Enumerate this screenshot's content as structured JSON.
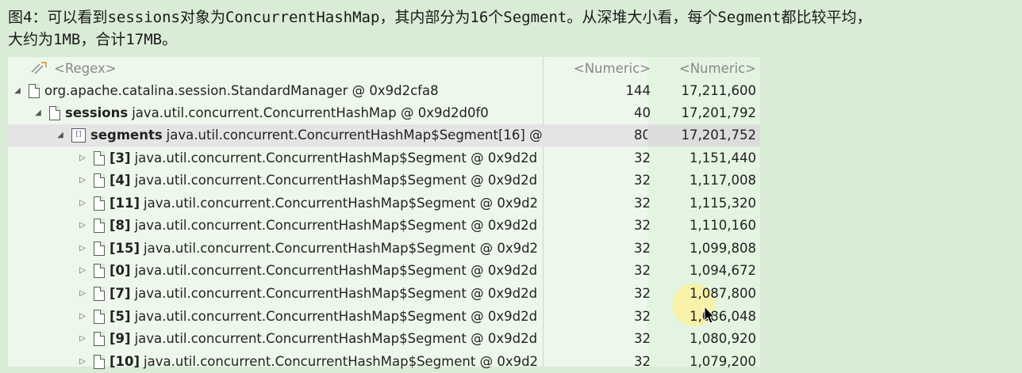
{
  "caption": {
    "line1": "图4：可以看到sessions对象为ConcurrentHashMap，其内部分为16个Segment。从深堆大小看，每个Segment都比较平均，",
    "line2": "大约为1MB，合计17MB。"
  },
  "header": {
    "regex": "<Regex>",
    "numeric1": "<Numeric>",
    "numeric2": "<Numeric>"
  },
  "rows": [
    {
      "label": "",
      "text": "org.apache.catalina.session.StandardManager @ 0x9d2cfa8",
      "n1": "144",
      "n2": "17,211,600"
    },
    {
      "label": "sessions",
      "text": "java.util.concurrent.ConcurrentHashMap @ 0x9d2d0f0",
      "n1": "40",
      "n2": "17,201,792"
    },
    {
      "label": "segments",
      "text": "java.util.concurrent.ConcurrentHashMap$Segment[16] @",
      "n1": "80",
      "n2": "17,201,752",
      "icon_text": "[]"
    },
    {
      "label": "[3]",
      "text": "java.util.concurrent.ConcurrentHashMap$Segment @ 0x9d2d",
      "n1": "32",
      "n2": "1,151,440"
    },
    {
      "label": "[4]",
      "text": "java.util.concurrent.ConcurrentHashMap$Segment @ 0x9d2d",
      "n1": "32",
      "n2": "1,117,008"
    },
    {
      "label": "[11]",
      "text": "java.util.concurrent.ConcurrentHashMap$Segment @ 0x9d2",
      "n1": "32",
      "n2": "1,115,320"
    },
    {
      "label": "[8]",
      "text": "java.util.concurrent.ConcurrentHashMap$Segment @ 0x9d2d",
      "n1": "32",
      "n2": "1,110,160"
    },
    {
      "label": "[15]",
      "text": "java.util.concurrent.ConcurrentHashMap$Segment @ 0x9d2",
      "n1": "32",
      "n2": "1,099,808"
    },
    {
      "label": "[0]",
      "text": "java.util.concurrent.ConcurrentHashMap$Segment @ 0x9d2d",
      "n1": "32",
      "n2": "1,094,672"
    },
    {
      "label": "[7]",
      "text": "java.util.concurrent.ConcurrentHashMap$Segment @ 0x9d2d",
      "n1": "32",
      "n2": "1,087,800"
    },
    {
      "label": "[5]",
      "text": "java.util.concurrent.ConcurrentHashMap$Segment @ 0x9d2d",
      "n1": "32",
      "n2": "1,086,048"
    },
    {
      "label": "[9]",
      "text": "java.util.concurrent.ConcurrentHashMap$Segment @ 0x9d2d",
      "n1": "32",
      "n2": "1,080,920"
    },
    {
      "label": "[10]",
      "text": "java.util.concurrent.ConcurrentHashMap$Segment @ 0x9d2",
      "n1": "32",
      "n2": "1,079,200"
    }
  ],
  "icons": {
    "expanded": "expanded-arrow-icon",
    "collapsed": "collapsed-arrow-icon",
    "object": "object-file-icon",
    "array": "array-file-icon",
    "regex": "regex-filter-icon",
    "cursor": "mouse-cursor-icon"
  },
  "colors": {
    "background": "#d9ecd6",
    "selected_row": "#e4e4e4",
    "numeric_highlight": "#e3f5e1"
  }
}
